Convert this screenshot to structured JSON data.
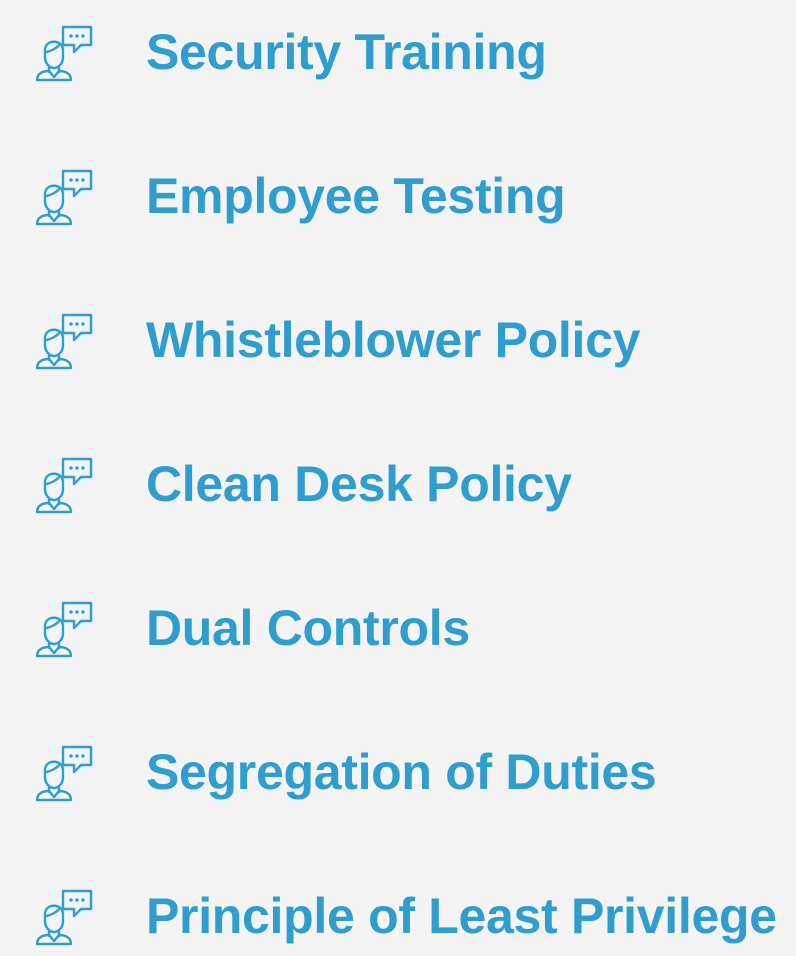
{
  "colors": {
    "background": "#f4f4f4",
    "accent": "#2f9dcd"
  },
  "items": [
    {
      "label": "Security Training",
      "icon": "person-speech-bubble-icon"
    },
    {
      "label": "Employee Testing",
      "icon": "person-speech-bubble-icon"
    },
    {
      "label": "Whistleblower Policy",
      "icon": "person-speech-bubble-icon"
    },
    {
      "label": "Clean Desk Policy",
      "icon": "person-speech-bubble-icon"
    },
    {
      "label": "Dual Controls",
      "icon": "person-speech-bubble-icon"
    },
    {
      "label": "Segregation of Duties",
      "icon": "person-speech-bubble-icon"
    },
    {
      "label": "Principle of Least Privilege",
      "icon": "person-speech-bubble-icon"
    }
  ]
}
